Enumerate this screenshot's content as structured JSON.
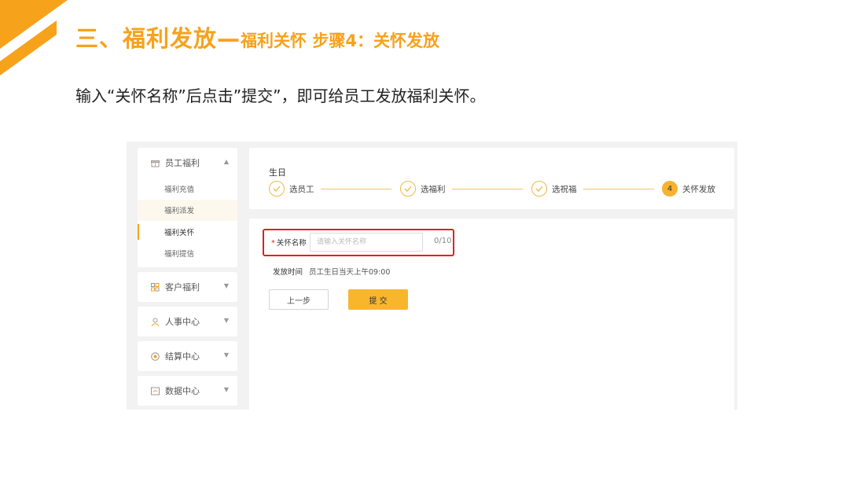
{
  "headline": {
    "main": "三、福利发放—",
    "sub": "福利关怀 步骤4：关怀发放"
  },
  "instruction": "输入“关怀名称”后点击”提交”，即可给员工发放福利关怀。",
  "colors": {
    "accent": "#f7a21b",
    "highlight_border": "#e02020",
    "button": "#f8b62d"
  },
  "sidebar": {
    "groups": [
      {
        "label": "员工福利",
        "icon": "gift-icon",
        "expanded": true,
        "items": [
          "福利充值",
          "福利派发",
          "福利关怀",
          "福利提信"
        ]
      },
      {
        "label": "客户福利",
        "icon": "group-icon",
        "expanded": false
      },
      {
        "label": "人事中心",
        "icon": "person-icon",
        "expanded": false
      },
      {
        "label": "结算中心",
        "icon": "coin-icon",
        "expanded": false
      },
      {
        "label": "数据中心",
        "icon": "chart-icon",
        "expanded": false
      }
    ],
    "active_item": "福利关怀"
  },
  "main": {
    "breadcrumb": "生日",
    "steps": [
      {
        "label": "选员工",
        "status": "done"
      },
      {
        "label": "选福利",
        "status": "done"
      },
      {
        "label": "选祝福",
        "status": "done"
      },
      {
        "label": "关怀发放",
        "status": "current",
        "number": "4"
      }
    ],
    "form": {
      "name_label": "关怀名称",
      "required_mark": "*",
      "name_placeholder": "请输入关怀名称",
      "name_counter": "0/10",
      "time_label": "发放时间",
      "time_value": "员工生日当天上午09:00"
    },
    "buttons": {
      "prev": "上一步",
      "submit": "提 交"
    }
  }
}
